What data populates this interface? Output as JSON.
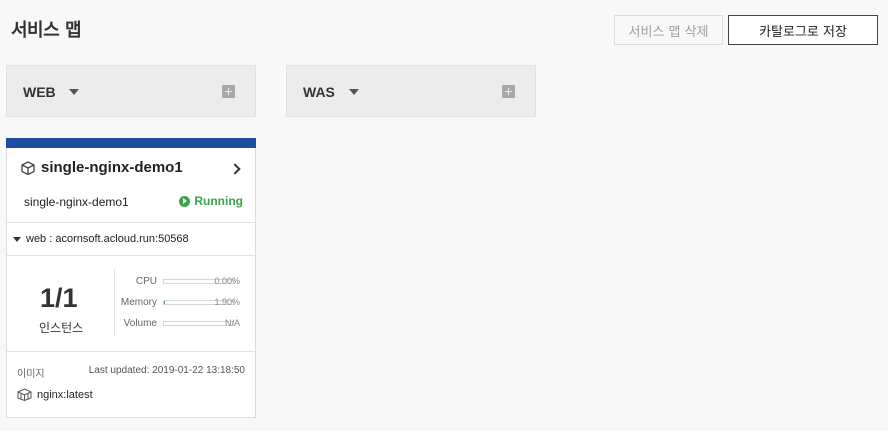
{
  "page": {
    "title": "서비스 맵"
  },
  "toolbar": {
    "delete_label": "서비스 맵 삭제",
    "save_label": "카탈로그로 저장"
  },
  "groups": [
    {
      "label": "WEB"
    },
    {
      "label": "WAS"
    }
  ],
  "service": {
    "title": "single-nginx-demo1",
    "name": "single-nginx-demo1",
    "status": "Running",
    "endpoint": "web : acornsoft.acloud.run:50568",
    "instances": "1/1",
    "instances_label": "인스턴스",
    "metrics": [
      {
        "label": "CPU",
        "value": "0.00%",
        "fraction": 0.0
      },
      {
        "label": "Memory",
        "value": "1.90%",
        "fraction": 0.019
      },
      {
        "label": "Volume",
        "value": "N/A",
        "fraction": 0
      }
    ],
    "image_label": "이미지",
    "last_updated": "Last updated: 2019-01-22 13:18:50",
    "image": "nginx:latest"
  },
  "colors": {
    "accent_bar": "#1f4ea1",
    "running": "#3aa34a",
    "metric_fill": "#3ab39b"
  },
  "icons": [
    "cube-icon",
    "chevron-right-icon",
    "play-icon",
    "caret-down-icon",
    "plus-square-icon",
    "image-box-icon"
  ]
}
